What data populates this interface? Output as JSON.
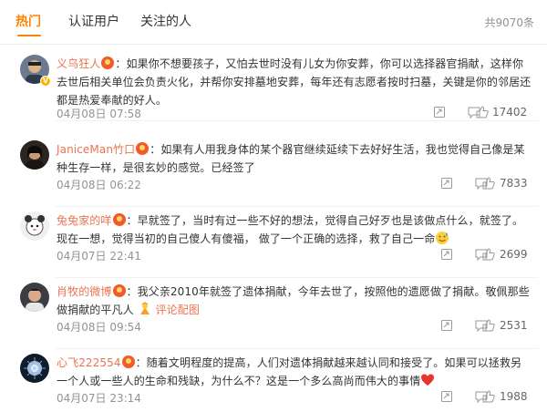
{
  "tabs": [
    {
      "label": "热门"
    },
    {
      "label": "认证用户"
    },
    {
      "label": "关注的人"
    }
  ],
  "total": "共9070条",
  "comments": [
    {
      "user": "义乌狂人",
      "text": "：如果你不想要孩子，又怕去世时没有儿女为你安葬，你可以选择器官捐献，这样你去世后相关单位会负责火化，并帮你安排墓地安葬，每年还有志愿者按时扫墓，关键是你的邻居还都是热爱奉献的好人。",
      "time": "04月08日 07:58",
      "likes": "17402",
      "verified": true
    },
    {
      "user": "JaniceMan竹口",
      "text": "：如果有人用我身体的某个器官继续延续下去好好生活，我也觉得自己像是某种生存一样，是很玄妙的感觉。已经签了",
      "time": "04月08日 06:22",
      "likes": "7833",
      "verified": false
    },
    {
      "user": "兔兔家的咩",
      "text": "：早就签了，当时有过一些不好的想法，觉得自己好歹也是该做点什么，就签了。现在一想，觉得当初的自己傻人有傻福， 做了一个正确的选择，救了自己一命",
      "time": "04月07日 22:41",
      "likes": "2699",
      "verified": false
    },
    {
      "user": "肖牧的微博",
      "text": "：我父亲2010年就签了遗体捐献，今年去世了，按照他的遗愿做了捐献。敬佩那些做捐献的平凡人",
      "link": "评论配图",
      "time": "04月08日 09:54",
      "likes": "2531",
      "verified": false
    },
    {
      "user": "心飞222554",
      "text": "：随着文明程度的提高，人们对遗体捐献越来越认同和接受了。如果可以拯救另一个人或一些人的生命和残缺，为什么不？这是一个多么高尚而伟大的事情",
      "time": "04月07日 23:14",
      "likes": "1988",
      "verified": false
    }
  ],
  "colors": {
    "accent": "#ff8200",
    "username": "#eb7350",
    "meta": "#939393"
  },
  "icons": [
    "medal-icon",
    "share-icon",
    "comment-icon",
    "like-icon",
    "verified-badge-icon",
    "fan-emoji-icon",
    "heart-emoji-icon",
    "sweat-emoji-icon"
  ]
}
